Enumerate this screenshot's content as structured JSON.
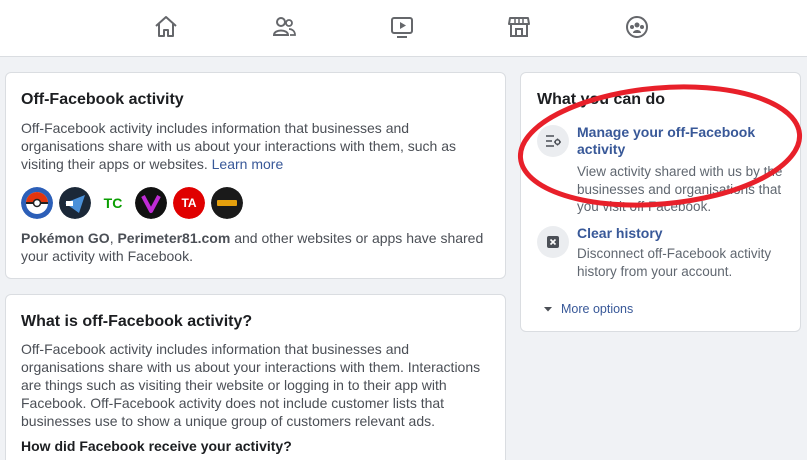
{
  "nav": {
    "icons": [
      "home-icon",
      "friends-icon",
      "watch-icon",
      "marketplace-icon",
      "groups-icon"
    ]
  },
  "main": {
    "title": "Off-Facebook activity",
    "desc_line1": "Off-Facebook activity includes information that businesses and",
    "desc_line2": "organisations share with us about your interactions with them, such as",
    "desc_line3_pre": "visiting their apps or websites. ",
    "learn_more": "Learn more",
    "apps": [
      {
        "name": "pokemon-go-logo",
        "color": "#2c5fb8"
      },
      {
        "name": "perimeter81-logo",
        "color": "#1b2838"
      },
      {
        "name": "techcrunch-logo",
        "color": "#0a9e01"
      },
      {
        "name": "v-app-logo",
        "color": "#6a0dad"
      },
      {
        "name": "ta-deals-logo",
        "color": "#e00000"
      },
      {
        "name": "hackerloop-logo",
        "color": "#1a1a1a"
      }
    ],
    "tc_text": "TC",
    "ta_text": "TA",
    "shared_app1": "Pokémon GO",
    "shared_sep": ", ",
    "shared_app2": "Perimeter81.com",
    "shared_rest1": " and other websites or apps have shared",
    "shared_rest2": "your activity with Facebook."
  },
  "what": {
    "title": "What is off-Facebook activity?",
    "lines": [
      "Off-Facebook activity includes information that businesses and",
      "organisations share with us about your interactions with them. Interactions",
      "are things such as visiting their website or logging in to their app with",
      "Facebook. Off-Facebook activity does not include customer lists that",
      "businesses use to show a unique group of customers relevant ads."
    ],
    "subhead": "How did Facebook receive your activity?"
  },
  "side": {
    "title": "What you can do",
    "manage": {
      "label1": "Manage your off-Facebook",
      "label2": "activity",
      "desc1": "View activity shared with us by the",
      "desc2": "businesses and organisations that",
      "desc3": "you visit off Facebook."
    },
    "clear": {
      "label": "Clear history",
      "desc1": "Disconnect off-Facebook activity",
      "desc2": "history from your account."
    },
    "more_options": "More options"
  },
  "annotation": {
    "color": "#e8202a"
  }
}
